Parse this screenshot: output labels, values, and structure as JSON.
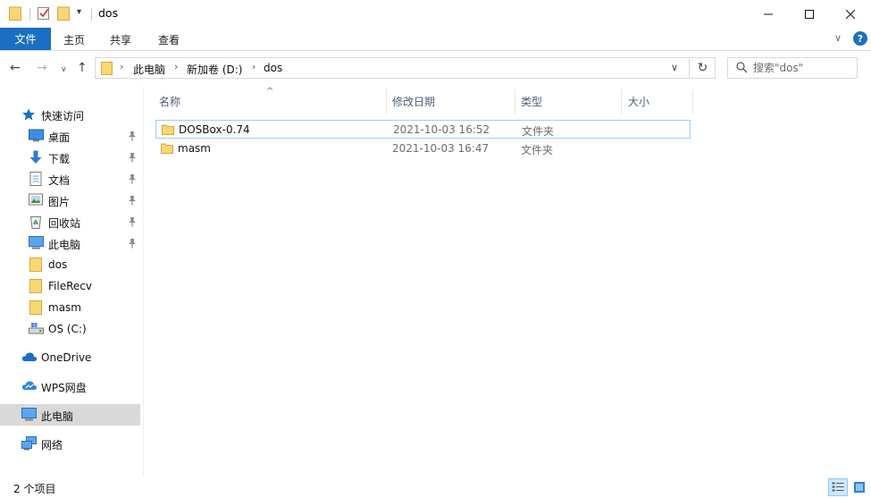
{
  "window": {
    "title": "dos",
    "minimize_glyph": "─",
    "maximize_glyph": "☐",
    "close_glyph": "✕"
  },
  "quick_access_toolbar": {
    "dropdown_glyph": "▾"
  },
  "ribbon": {
    "tabs": [
      {
        "label": "文件"
      },
      {
        "label": "主页"
      },
      {
        "label": "共享"
      },
      {
        "label": "查看"
      }
    ],
    "expand_glyph": "∨",
    "help_glyph": "?"
  },
  "navigation": {
    "back_glyph": "←",
    "forward_glyph": "→",
    "recent_glyph": "∨",
    "up_glyph": "↑",
    "breadcrumb": [
      "此电脑",
      "新加卷 (D:)",
      "dos"
    ],
    "crumb_separator": "›",
    "address_dropdown_glyph": "∨",
    "refresh_glyph": "↻",
    "search_placeholder": "搜索\"dos\""
  },
  "sidebar": {
    "items": [
      {
        "label": "快速访问",
        "icon": "star-icon",
        "pinned": false
      },
      {
        "label": "桌面",
        "icon": "desktop-icon",
        "pinned": true
      },
      {
        "label": "下载",
        "icon": "download-icon",
        "pinned": true
      },
      {
        "label": "文档",
        "icon": "documents-icon",
        "pinned": true
      },
      {
        "label": "图片",
        "icon": "pictures-icon",
        "pinned": true
      },
      {
        "label": "回收站",
        "icon": "recycle-bin-icon",
        "pinned": true
      },
      {
        "label": "此电脑",
        "icon": "computer-icon",
        "pinned": true
      },
      {
        "label": "dos",
        "icon": "folder-icon",
        "pinned": false
      },
      {
        "label": "FileRecv",
        "icon": "folder-icon",
        "pinned": false
      },
      {
        "label": "masm",
        "icon": "folder-icon",
        "pinned": false
      },
      {
        "label": "OS (C:)",
        "icon": "drive-icon",
        "pinned": false
      },
      {
        "label": "OneDrive",
        "icon": "cloud-icon",
        "pinned": false
      },
      {
        "label": "WPS网盘",
        "icon": "cloud-icon",
        "pinned": false
      },
      {
        "label": "此电脑",
        "icon": "computer-icon",
        "pinned": false,
        "selected": true
      },
      {
        "label": "网络",
        "icon": "network-icon",
        "pinned": false
      }
    ]
  },
  "file_list": {
    "columns": [
      "名称",
      "修改日期",
      "类型",
      "大小"
    ],
    "sort_glyph": "^",
    "rows": [
      {
        "name": "DOSBox-0.74",
        "date": "2021-10-03 16:52",
        "type": "文件夹",
        "size": ""
      },
      {
        "name": "masm",
        "date": "2021-10-03 16:47",
        "type": "文件夹",
        "size": ""
      }
    ]
  },
  "status_bar": {
    "item_count": "2 个项目"
  },
  "colors": {
    "accent": "#1a6fc2",
    "selection_border": "#99d1ff",
    "selected_nav_bg": "#d9d9d9",
    "header_text": "#4c607a",
    "folder_yellow": "#f8d775"
  }
}
